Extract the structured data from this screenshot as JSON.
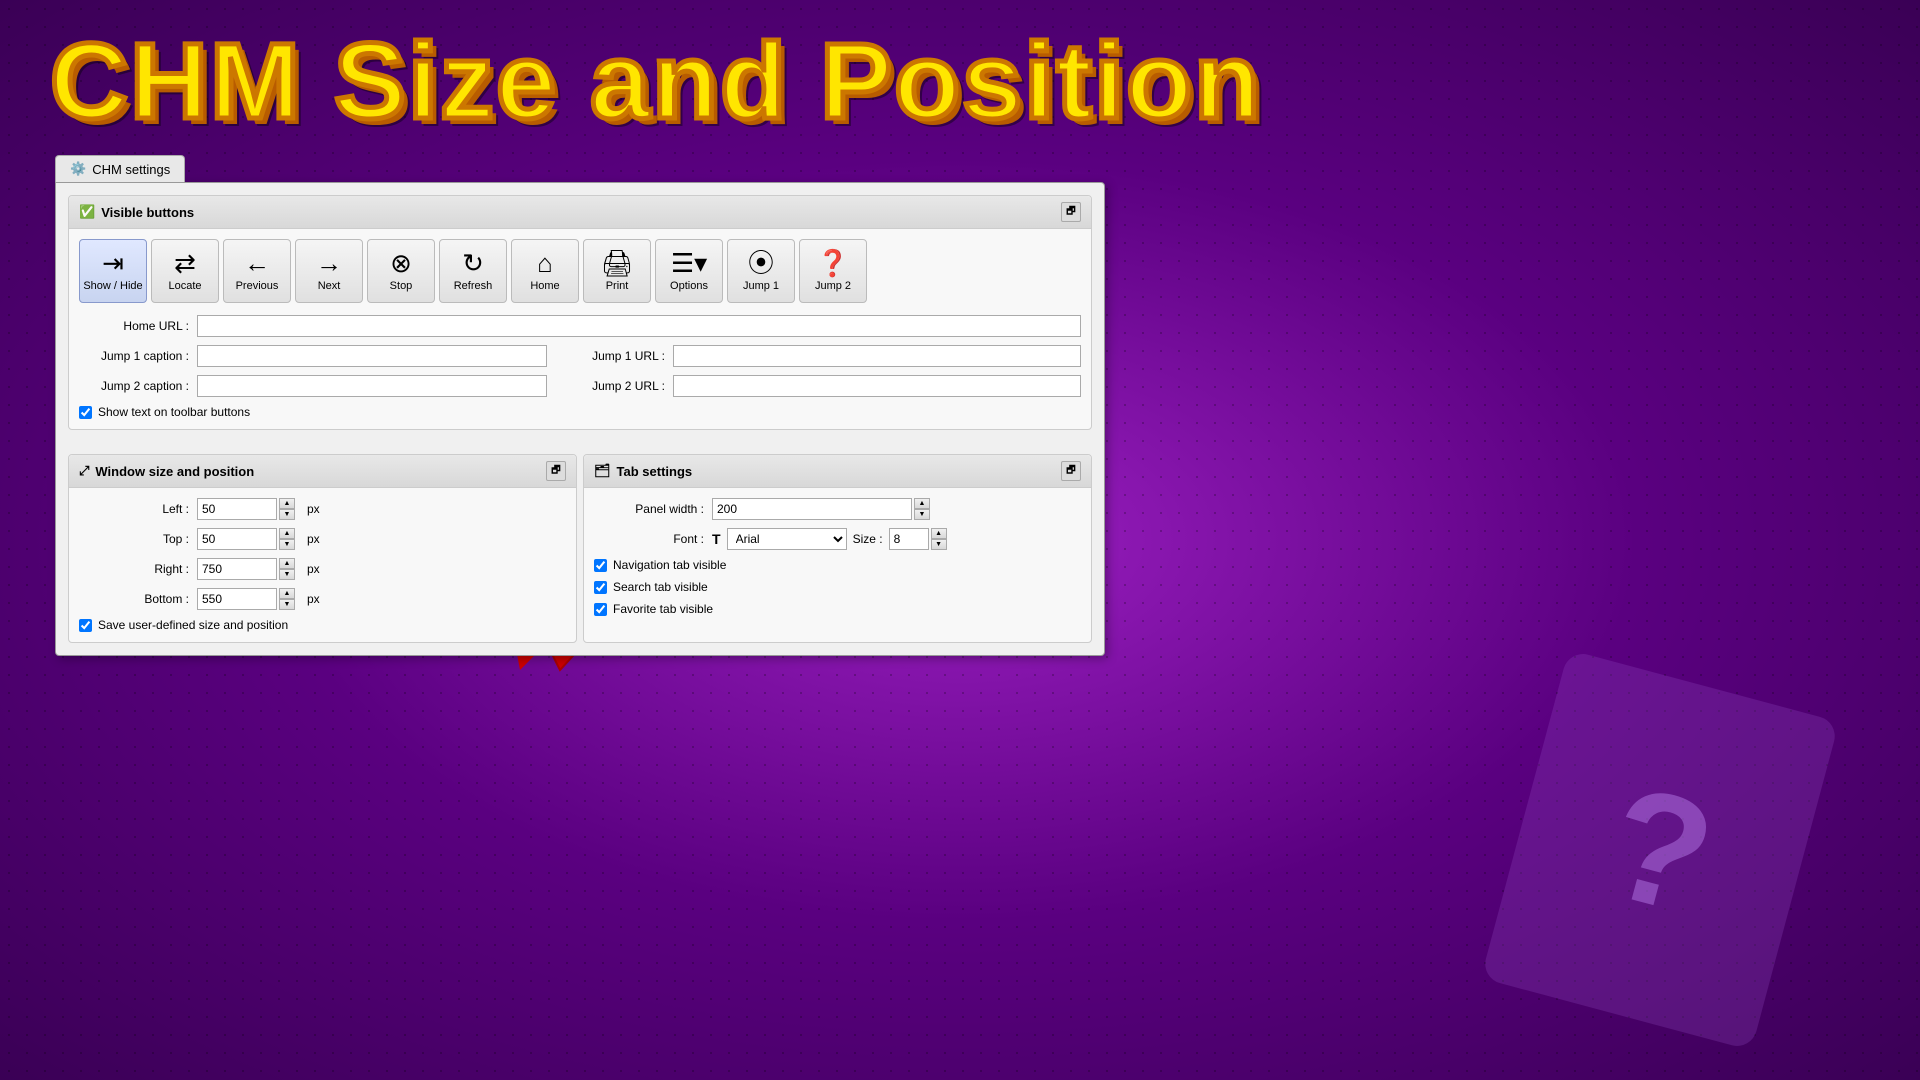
{
  "title": "CHM Size and Position",
  "tab": {
    "label": "CHM settings",
    "icon": "⚙"
  },
  "visible_buttons_section": {
    "header": "Visible buttons",
    "buttons": [
      {
        "id": "show-hide",
        "icon": "⇥⇤",
        "label": "Show / Hide",
        "active": true
      },
      {
        "id": "locate",
        "icon": "⇄",
        "label": "Locate",
        "active": false
      },
      {
        "id": "previous",
        "icon": "←",
        "label": "Previous",
        "active": false
      },
      {
        "id": "next",
        "icon": "→",
        "label": "Next",
        "active": false
      },
      {
        "id": "stop",
        "icon": "⊗",
        "label": "Stop",
        "active": false
      },
      {
        "id": "refresh",
        "icon": "↻",
        "label": "Refresh",
        "active": false
      },
      {
        "id": "home",
        "icon": "⌂",
        "label": "Home",
        "active": false
      },
      {
        "id": "print",
        "icon": "🖨",
        "label": "Print",
        "active": false
      },
      {
        "id": "options",
        "icon": "▼",
        "label": "Options",
        "active": false
      },
      {
        "id": "jump1",
        "icon": "⦿",
        "label": "Jump 1",
        "active": false
      },
      {
        "id": "jump2",
        "icon": "❓",
        "label": "Jump 2",
        "active": false
      }
    ],
    "home_url_label": "Home URL :",
    "home_url_value": "",
    "jump1_caption_label": "Jump 1 caption :",
    "jump1_caption_value": "",
    "jump1_url_label": "Jump 1 URL :",
    "jump1_url_value": "",
    "jump2_caption_label": "Jump 2 caption :",
    "jump2_caption_value": "",
    "jump2_url_label": "Jump 2 URL :",
    "jump2_url_value": "",
    "show_text_label": "Show text on toolbar buttons",
    "show_text_checked": true
  },
  "window_size_section": {
    "header": "Window size and position",
    "left_label": "Left :",
    "left_value": "50",
    "top_label": "Top :",
    "top_value": "50",
    "right_label": "Right :",
    "right_value": "750",
    "bottom_label": "Bottom :",
    "bottom_value": "550",
    "px": "px",
    "save_label": "Save user-defined size and position",
    "save_checked": true
  },
  "tab_settings_section": {
    "header": "Tab settings",
    "panel_width_label": "Panel width :",
    "panel_width_value": "200",
    "font_label": "Font :",
    "font_value": "Arial",
    "size_label": "Size :",
    "size_value": "8",
    "nav_tab_label": "Navigation tab visible",
    "nav_tab_checked": true,
    "search_tab_label": "Search tab visible",
    "search_tab_checked": true,
    "fav_tab_label": "Favorite tab visible",
    "fav_tab_checked": true
  }
}
